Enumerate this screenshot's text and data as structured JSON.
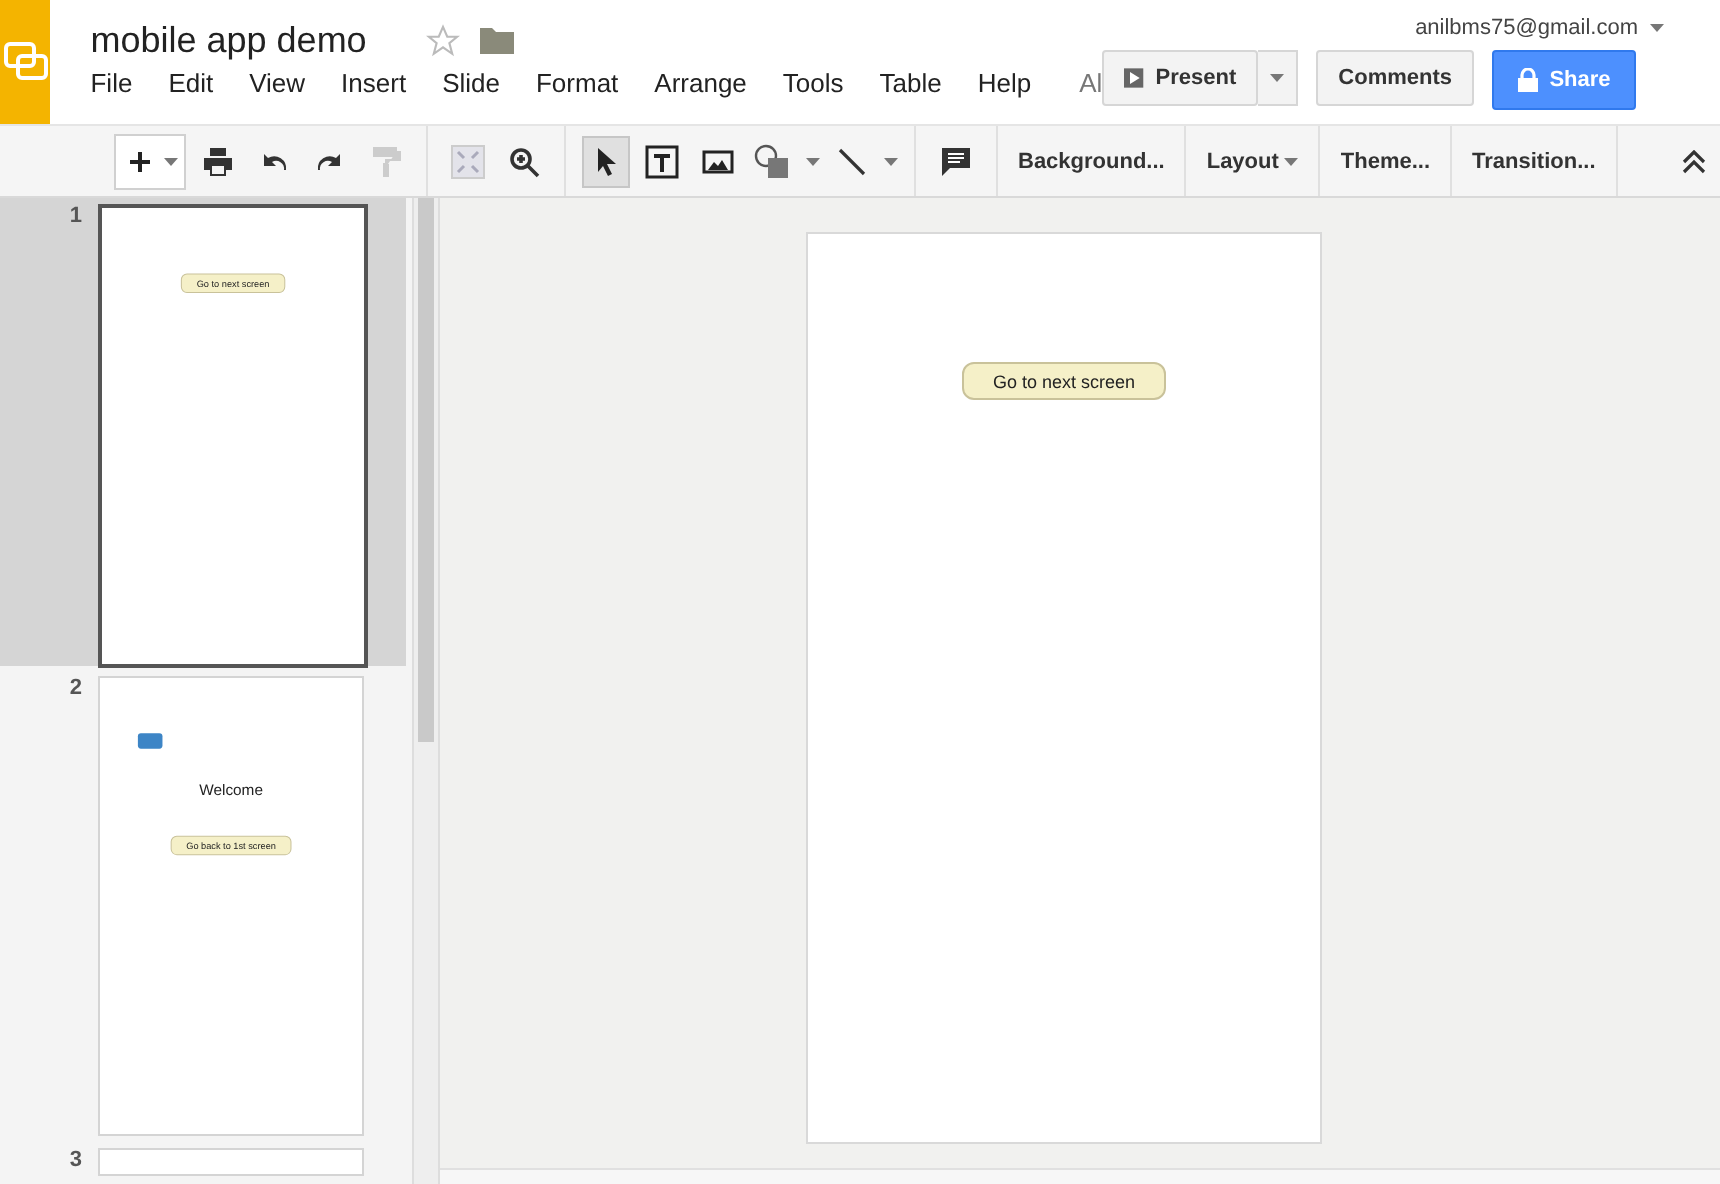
{
  "app": {
    "title": "mobile app demo",
    "starred": false,
    "account": "anilbms75@gmail.com"
  },
  "menu": [
    {
      "label": "File"
    },
    {
      "label": "Edit"
    },
    {
      "label": "View"
    },
    {
      "label": "Insert"
    },
    {
      "label": "Slide"
    },
    {
      "label": "Format"
    },
    {
      "label": "Arrange"
    },
    {
      "label": "Tools"
    },
    {
      "label": "Table"
    },
    {
      "label": "Help"
    }
  ],
  "save_status": "Al",
  "actions": {
    "present": "Present",
    "comments": "Comments",
    "share": "Share"
  },
  "tools": [
    {
      "kind": "select",
      "selected": true
    },
    {
      "kind": "text",
      "selected": false
    },
    {
      "kind": "image",
      "selected": false
    },
    {
      "kind": "shape",
      "selected": false
    },
    {
      "kind": "line",
      "selected": false
    }
  ],
  "toolbar_buttons": [
    {
      "label": "Background...",
      "menu": false
    },
    {
      "label": "Layout",
      "menu": true
    },
    {
      "label": "Theme...",
      "menu": false
    },
    {
      "label": "Transition...",
      "menu": false
    }
  ],
  "slides": [
    {
      "number": "1",
      "selected": true,
      "elements": [
        {
          "kind": "button",
          "text": "Go to next screen"
        }
      ]
    },
    {
      "number": "2",
      "selected": false,
      "elements": [
        {
          "kind": "chip"
        },
        {
          "kind": "heading",
          "text": "Welcome"
        },
        {
          "kind": "button",
          "text": "Go back to 1st screen"
        }
      ]
    },
    {
      "number": "3",
      "selected": false
    }
  ],
  "canvas": {
    "elements": [
      {
        "kind": "button",
        "text": "Go to next screen"
      }
    ]
  }
}
